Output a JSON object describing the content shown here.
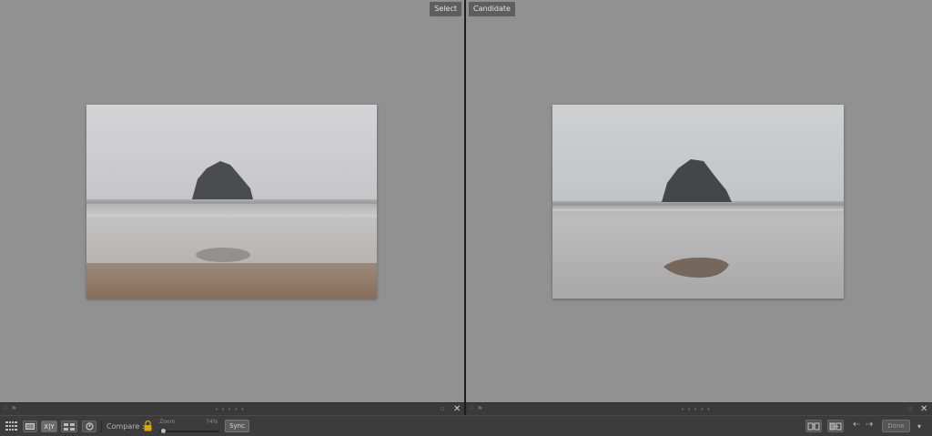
{
  "left_pane": {
    "tag": "Select"
  },
  "right_pane": {
    "tag": "Candidate"
  },
  "toolbar": {
    "compare_label": "Compare :",
    "zoom_label": "Zoom",
    "zoom_value": "74%",
    "sync_label": "Sync",
    "done_label": "Done"
  },
  "icons": {
    "grid": "grid-view-icon",
    "loupe": "loupe-view-icon",
    "compare": "compare-view-icon",
    "survey": "survey-view-icon",
    "people": "people-view-icon",
    "lock": "lock-icon",
    "swap": "swap-icon",
    "make_select": "make-select-icon",
    "prev": "arrow-left-icon",
    "next": "arrow-right-icon",
    "menu": "chevron-down-icon",
    "close": "close-icon"
  },
  "colors": {
    "pane_background": "#919191",
    "toolbar_background": "#3c3c3c",
    "lock_icon": "#d9a90f"
  }
}
